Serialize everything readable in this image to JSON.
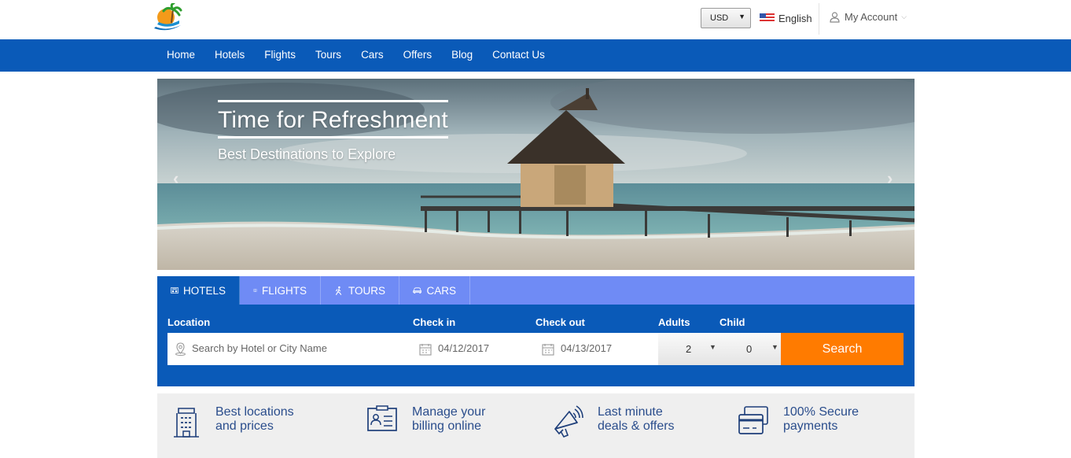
{
  "header": {
    "currency": "USD",
    "language": "English",
    "account": "My Account"
  },
  "nav": {
    "items": [
      "Home",
      "Hotels",
      "Flights",
      "Tours",
      "Cars",
      "Offers",
      "Blog",
      "Contact Us"
    ]
  },
  "hero": {
    "title": "Time for Refreshment",
    "subtitle": "Best Destinations to Explore"
  },
  "search": {
    "tabs": [
      "HOTELS",
      "FLIGHTS",
      "TOURS",
      "CARS"
    ],
    "labels": {
      "location": "Location",
      "checkin": "Check in",
      "checkout": "Check out",
      "adults": "Adults",
      "child": "Child"
    },
    "location_placeholder": "Search by Hotel or City Name",
    "checkin_value": "04/12/2017",
    "checkout_value": "04/13/2017",
    "adults_value": "2",
    "child_value": "0",
    "button": "Search"
  },
  "features": [
    {
      "line1": "Best locations",
      "line2": "and prices"
    },
    {
      "line1": "Manage your",
      "line2": "billing online"
    },
    {
      "line1": "Last minute",
      "line2": "deals & offers"
    },
    {
      "line1": "100% Secure",
      "line2": "payments"
    }
  ],
  "colors": {
    "primary": "#0a5ab8",
    "tabbar": "#6f8bf5",
    "accent": "#ff7b00"
  }
}
